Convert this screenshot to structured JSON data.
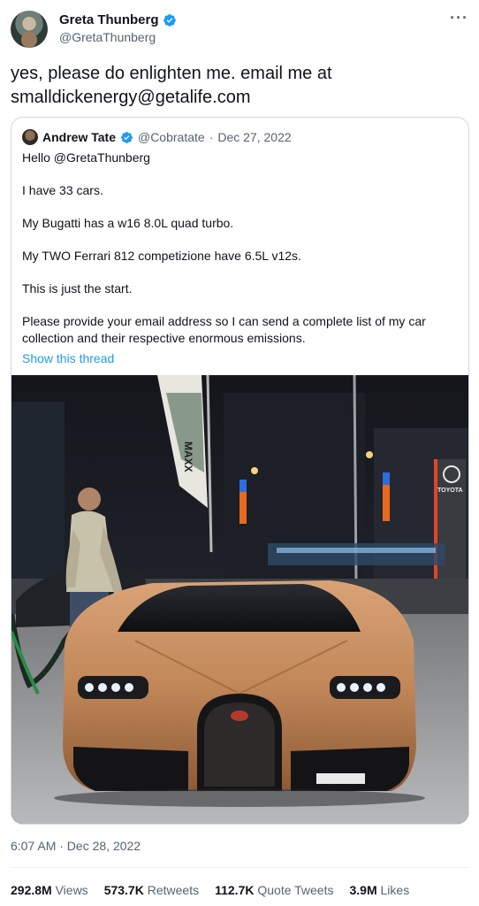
{
  "author": {
    "display_name": "Greta Thunberg",
    "handle": "@GretaThunberg"
  },
  "more_icon": "more-dots-icon",
  "tweet_text": "yes, please do enlighten me. email me at smalldickenergy@getalife.com",
  "quoted": {
    "display_name": "Andrew Tate",
    "handle": "@Cobratate",
    "separator": "·",
    "date": "Dec 27, 2022",
    "paragraphs": [
      "Hello @GretaThunberg",
      "I have 33 cars.",
      "My Bugatti has a w16 8.0L quad turbo.",
      "My TWO Ferrari 812 competizione have 6.5L v12s.",
      "This is just the start.",
      "Please provide your email address so I can send a complete list of my car collection and their respective enormous emissions."
    ],
    "show_thread": "Show this thread",
    "photo": {
      "flag_text": "MAXX",
      "dealer_sign": "TOYOTA"
    }
  },
  "timestamp": "6:07 AM · Dec 28, 2022",
  "stats": [
    {
      "value": "292.8M",
      "label": "Views"
    },
    {
      "value": "573.7K",
      "label": "Retweets"
    },
    {
      "value": "112.7K",
      "label": "Quote Tweets"
    },
    {
      "value": "3.9M",
      "label": "Likes"
    }
  ],
  "colors": {
    "verified": "#1d9bf0",
    "link": "#1d9bf0",
    "secondary_text": "#536471"
  }
}
